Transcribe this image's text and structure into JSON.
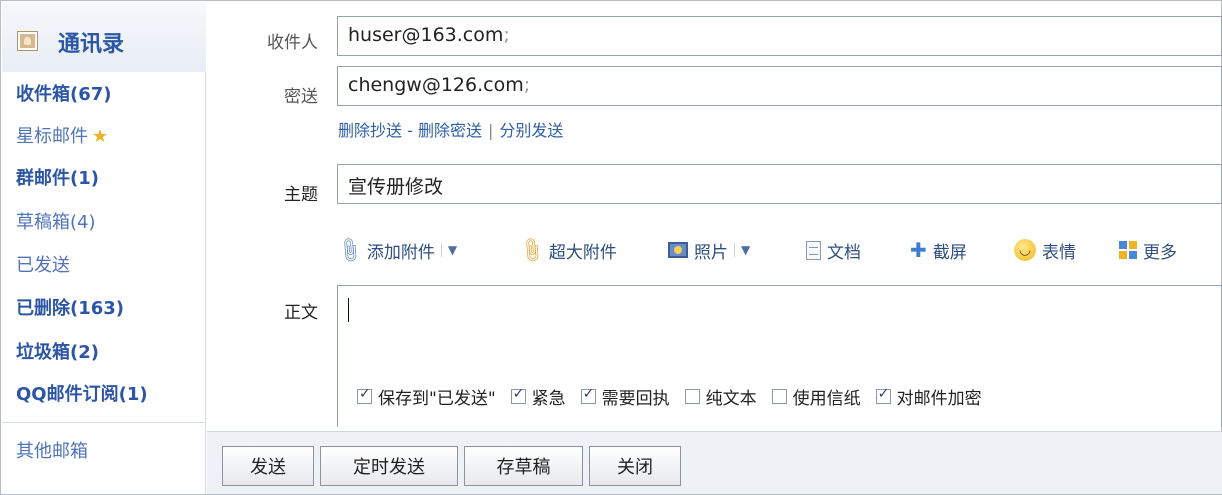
{
  "sidebar": {
    "header": {
      "label": "通讯录",
      "icon": "contact-card-icon"
    },
    "items": [
      {
        "label": "收件箱(67)",
        "bold": true
      },
      {
        "label": "星标邮件",
        "bold": false,
        "icon": "star-icon"
      },
      {
        "label": "群邮件(1)",
        "bold": true
      },
      {
        "label": "草稿箱(4)",
        "bold": false
      },
      {
        "label": "已发送",
        "bold": false
      },
      {
        "label": "已删除(163)",
        "bold": true
      },
      {
        "label": "垃圾箱(2)",
        "bold": true
      },
      {
        "label": "QQ邮件订阅(1)",
        "bold": true
      },
      {
        "label": "其他邮箱",
        "bold": false
      }
    ]
  },
  "compose": {
    "to_label": "收件人",
    "to_value": "huser@163.com",
    "to_separator": ";",
    "bcc_label": "密送",
    "bcc_value": "chengw@126.com",
    "bcc_separator": ";",
    "links": {
      "remove_cc": "删除抄送",
      "dash": "-",
      "remove_bcc": "删除密送",
      "pipe": "|",
      "send_separately": "分别发送"
    },
    "subject_label": "主题",
    "subject_value": "宣传册修改",
    "body_label": "正文",
    "toolbar": {
      "attach": "添加附件",
      "big_attach": "超大附件",
      "photo": "照片",
      "document": "文档",
      "screenshot": "截屏",
      "emoji": "表情",
      "more": "更多"
    },
    "options": [
      {
        "label": "保存到\"已发送\"",
        "checked": true
      },
      {
        "label": "紧急",
        "checked": true
      },
      {
        "label": "需要回执",
        "checked": true
      },
      {
        "label": "纯文本",
        "checked": false
      },
      {
        "label": "使用信纸",
        "checked": false
      },
      {
        "label": "对邮件加密",
        "checked": true
      }
    ]
  },
  "actions": {
    "send": "发送",
    "scheduled_send": "定时发送",
    "save_draft": "存草稿",
    "close": "关闭"
  },
  "colors": {
    "link": "#2f5fa7",
    "sidebar_bold": "#2c56a5",
    "star": "#f2b322",
    "border": "#9aa3ad"
  }
}
